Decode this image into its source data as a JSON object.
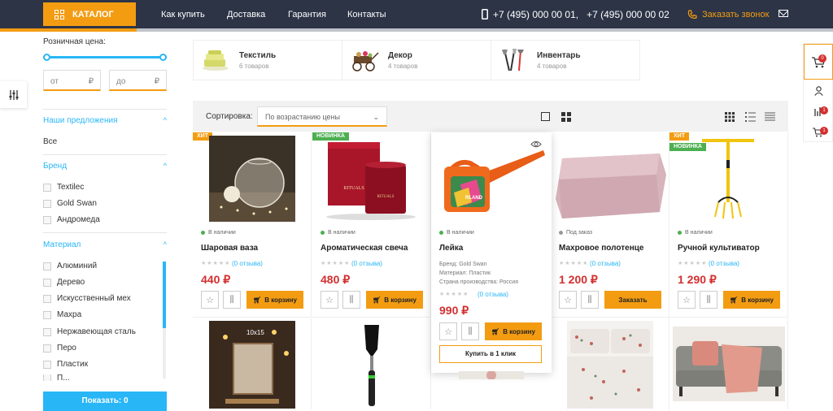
{
  "header": {
    "catalog_label": "КАТАЛОГ",
    "nav": [
      "Как купить",
      "Доставка",
      "Гарантия",
      "Контакты"
    ],
    "phone1": "+7 (495) 000 00 01,",
    "phone2": "+7 (495) 000 00 02",
    "callback_label": "Заказать звонок"
  },
  "filters": {
    "price_label": "Розничная цена:",
    "from_placeholder": "от",
    "to_placeholder": "до",
    "currency": "₽",
    "offers_title": "Наши предложения",
    "offers_all": "Все",
    "brand_title": "Бренд",
    "brands": [
      "Textilec",
      "Gold Swan",
      "Андромеда"
    ],
    "material_title": "Материал",
    "materials": [
      "Алюминий",
      "Дерево",
      "Искусственный мех",
      "Махра",
      "Нержавеющая сталь",
      "Перо",
      "Пластик",
      "П..."
    ],
    "show_label": "Показать: 0"
  },
  "categories": [
    {
      "name": "Текстиль",
      "count": "6 товаров"
    },
    {
      "name": "Декор",
      "count": "4 товаров"
    },
    {
      "name": "Инвентарь",
      "count": "4 товаров"
    }
  ],
  "sort": {
    "label": "Сортировка:",
    "value": "По возрастанию цены"
  },
  "products": [
    {
      "name": "Шаровая ваза",
      "status": "В наличии",
      "reviews": "(0 отзыва)",
      "price": "440 ₽",
      "button": "В корзину",
      "badges": [
        "ХИТ"
      ]
    },
    {
      "name": "Ароматическая свеча",
      "status": "В наличии",
      "reviews": "(0 отзыва)",
      "price": "480 ₽",
      "button": "В корзину",
      "badges": [
        "НОВИНКА"
      ]
    },
    {
      "name": "Лейка",
      "status": "В наличии",
      "reviews": "(0 отзыва)",
      "price": "990 ₽",
      "button": "В корзину",
      "badges": [],
      "brand": "Бренд: Gold Swan",
      "material": "Материал: Пластик",
      "country": "Страна производства: Россия",
      "oneclick": "Купить в 1 клик"
    },
    {
      "name": "Махровое полотенце",
      "status": "Под заказ",
      "reviews": "(0 отзыва)",
      "price": "1 200 ₽",
      "button": "Заказать",
      "badges": []
    },
    {
      "name": "Ручной культиватор",
      "status": "В наличии",
      "reviews": "(0 отзыва)",
      "price": "1 290 ₽",
      "button": "В корзину",
      "badges": [
        "ХИТ",
        "НОВИНКА"
      ]
    }
  ],
  "second_row": {
    "frame_caption": "10x15"
  },
  "right_panel": {
    "cart_count": "0",
    "compare_count": "1",
    "favorites_count": "1"
  },
  "colors": {
    "accent": "#f39c12",
    "link": "#29b6f6",
    "price": "#d32f2f",
    "header_bg": "#2c3446"
  }
}
